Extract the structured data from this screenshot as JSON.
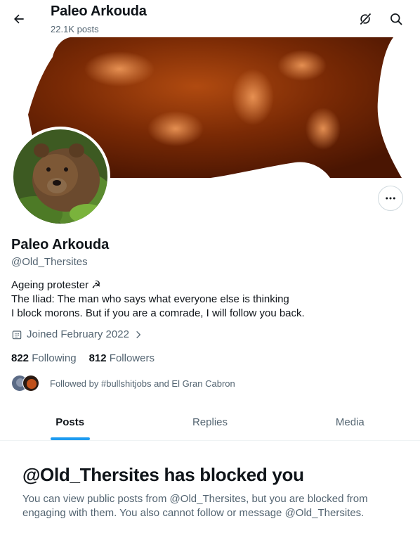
{
  "header": {
    "title": "Paleo Arkouda",
    "post_count": "22.1K posts",
    "back_icon": "arrow-left-icon",
    "grok_icon": "grok-icon",
    "search_icon": "search-icon"
  },
  "profile": {
    "display_name": "Paleo Arkouda",
    "handle": "@Old_Thersites",
    "bio_lines": [
      "Ageing protester ☭",
      "The Iliad: The man who says what everyone else is thinking",
      "I block morons. But if you are a comrade, I will follow you back."
    ],
    "joined": "Joined February 2022",
    "following_count": "822",
    "following_label": "Following",
    "followers_count": "812",
    "followers_label": "Followers",
    "followed_by": "Followed by #bullshitjobs and El Gran Cabron",
    "more_icon": "more-options-icon"
  },
  "tabs": [
    {
      "label": "Posts",
      "active": true
    },
    {
      "label": "Replies",
      "active": false
    },
    {
      "label": "Media",
      "active": false
    }
  ],
  "blocked": {
    "title": "@Old_Thersites has blocked you",
    "description": "You can view public posts from @Old_Thersites, but you are blocked from engaging with them. You also cannot follow or message @Old_Thersites."
  },
  "colors": {
    "accent": "#1d9bf0",
    "text_primary": "#0f1419",
    "text_secondary": "#536471",
    "banner_bear": "#7a2a05"
  }
}
